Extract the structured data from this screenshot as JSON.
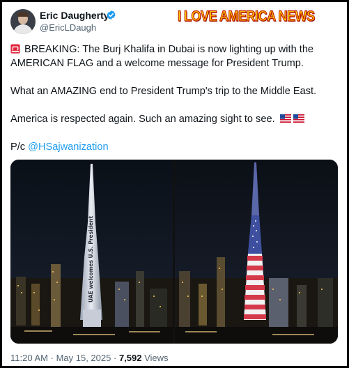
{
  "author": {
    "name": "Eric Daugherty",
    "handle": "@EricLDaugh"
  },
  "overlay_banner": "I LOVE AMERICA NEWS",
  "tweet": {
    "line1": "BREAKING: The Burj Khalifa in Dubai is now lighting up with the",
    "line2": "AMERICAN FLAG and a welcome message for President Trump.",
    "line3": "What an AMAZING end to President Trump's trip to the Middle East.",
    "line4": "America is respected again. Such an amazing sight to see.",
    "credit_prefix": "P/c",
    "credit_mention": "@HSajwanization"
  },
  "media": {
    "left_tower_text": "UAE welcomes U.S. President"
  },
  "meta": {
    "time": "11:20 AM",
    "separator": "·",
    "date": "May 15, 2025",
    "views_count": "7,592",
    "views_label": "Views"
  },
  "colors": {
    "link": "#1d9bf0",
    "verified": "#1d9bf0",
    "banner_fill": "#ffd000",
    "banner_stroke": "#c21a00"
  },
  "icons": [
    "verified-badge-icon",
    "siren-emoji-icon",
    "us-flag-emoji-icon"
  ]
}
